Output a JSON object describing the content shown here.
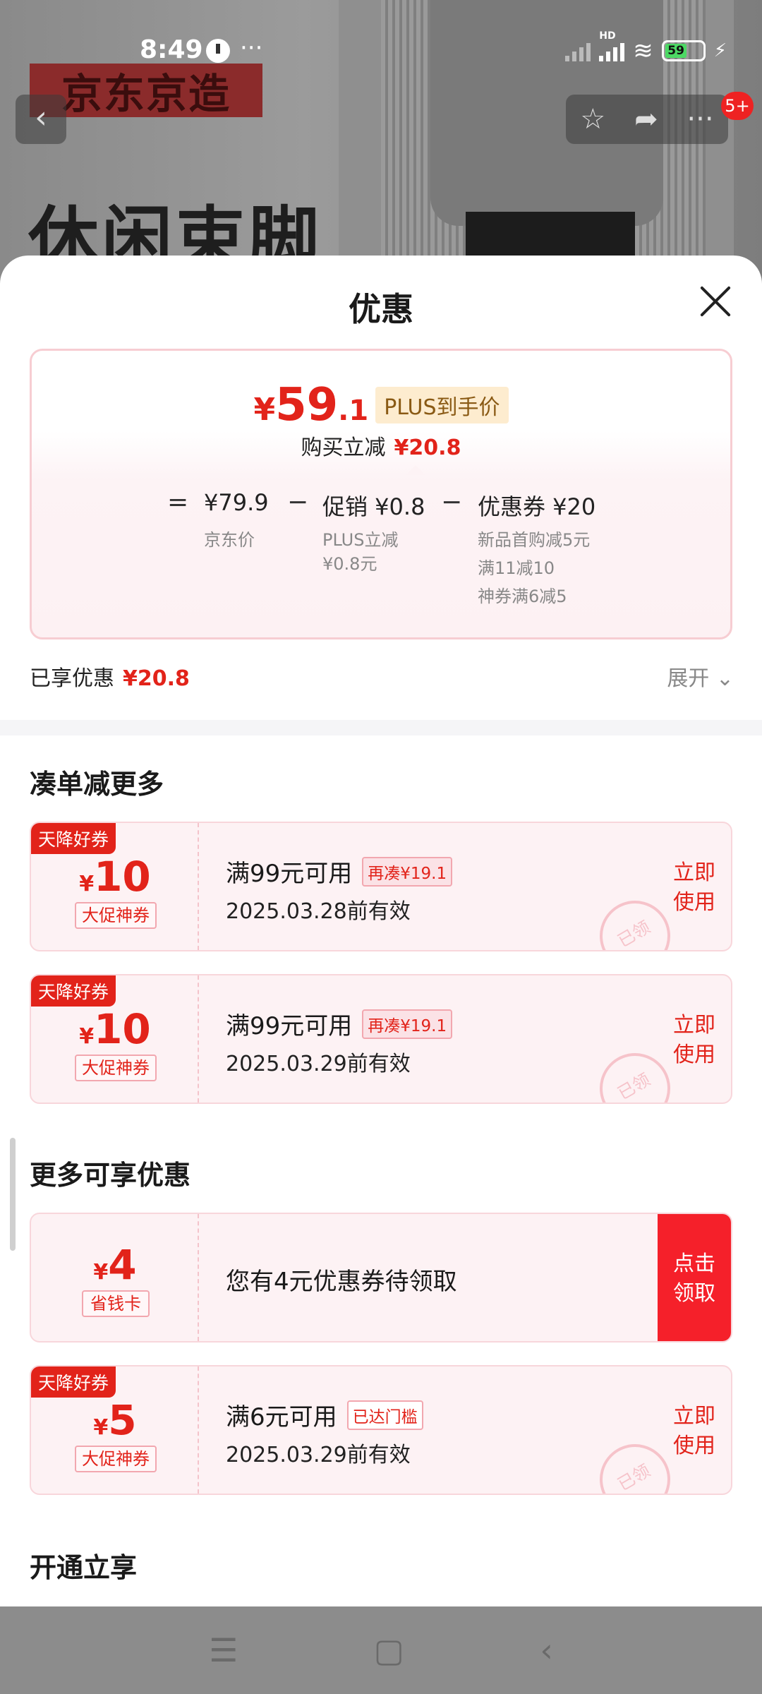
{
  "status_bar": {
    "time": "8:49",
    "dots": "···",
    "battery": "59",
    "bolt": "⚡",
    "wifi": "≋",
    "network": "HD"
  },
  "product_page": {
    "brand": "京东京造",
    "title": "休闲束脚",
    "badge": "5+",
    "back": "‹",
    "star": "☆",
    "share": "➦",
    "more": "···"
  },
  "sheet": {
    "title": "优惠",
    "final": {
      "currency": "¥",
      "integer": "59",
      "decimal": ".1",
      "tag": "PLUS到手价",
      "instant_label": "购买立减",
      "instant_amount": "¥20.8"
    },
    "breakdown": {
      "eq": "=",
      "minus1": "−",
      "minus2": "−",
      "base_price": "¥79.9",
      "base_label": "京东价",
      "promo_price": "促销 ¥0.8",
      "promo_sub1": "PLUS立减",
      "promo_sub2": "¥0.8元",
      "coupon_price": "优惠券 ¥20",
      "coupon_sub1": "新品首购减5元",
      "coupon_sub2": "满11减10",
      "coupon_sub3": "神券满6减5"
    },
    "enjoyed_label": "已享优惠",
    "enjoyed_amount": "¥20.8",
    "expand": "展开 ⌄"
  },
  "sections": {
    "bundle": "凑单减更多",
    "more": "更多可享优惠",
    "open": "开通立享"
  },
  "coupons": [
    {
      "tag": "天降好券",
      "sym": "¥",
      "value": "10",
      "kind": "大促神券",
      "condition": "满99元可用",
      "hint": "再凑¥19.1",
      "expire": "2025.03.28前有效",
      "cta_1": "立即",
      "cta_2": "使用",
      "stamp": "已领"
    },
    {
      "tag": "天降好券",
      "sym": "¥",
      "value": "10",
      "kind": "大促神券",
      "condition": "满99元可用",
      "hint": "再凑¥19.1",
      "expire": "2025.03.29前有效",
      "cta_1": "立即",
      "cta_2": "使用",
      "stamp": "已领"
    },
    {
      "sym": "¥",
      "value": "4",
      "kind": "省钱卡",
      "condition": "您有4元优惠券待领取",
      "cta_1": "点击",
      "cta_2": "领取"
    },
    {
      "tag": "天降好券",
      "sym": "¥",
      "value": "5",
      "kind": "大促神券",
      "condition": "满6元可用",
      "hint": "已达门槛",
      "expire": "2025.03.29前有效",
      "cta_1": "立即",
      "cta_2": "使用",
      "stamp": "已领"
    }
  ],
  "nav_bar": {
    "menu": "☰",
    "home": "▢",
    "back": "‹"
  },
  "colors": {
    "accent": "#e2231a",
    "plus_bg": "#fdeccf",
    "coupon_bg": "#fdf2f4"
  }
}
